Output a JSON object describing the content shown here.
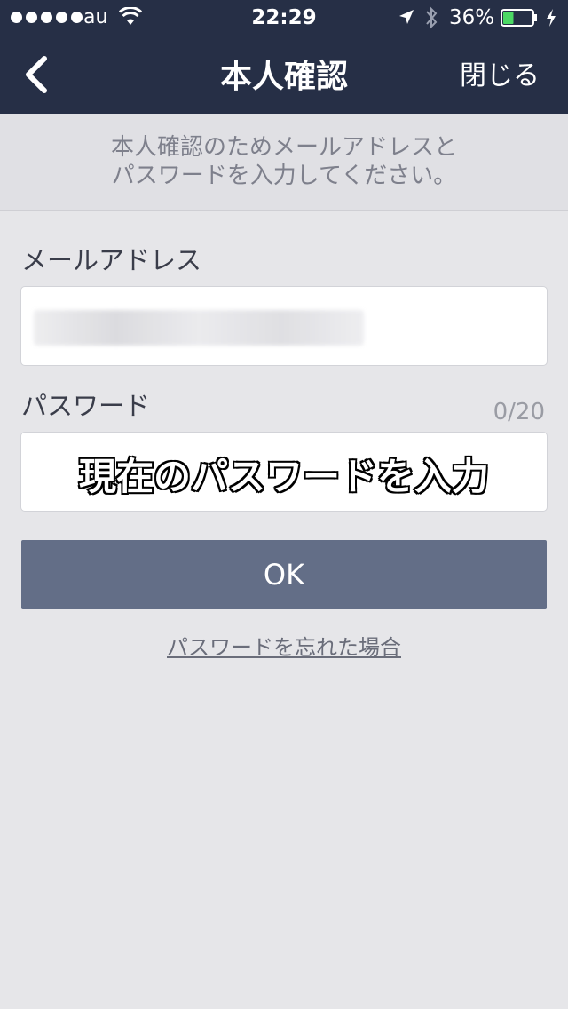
{
  "status_bar": {
    "carrier": "au",
    "time": "22:29",
    "battery_percent": "36%",
    "battery_level": 0.36,
    "battery_color": "#4cd964"
  },
  "nav": {
    "title": "本人確認",
    "close_label": "閉じる",
    "back_icon": "chevron-left-icon",
    "bar_color": "#262f46"
  },
  "notice": {
    "line1": "本人確認のためメールアドレスと",
    "line2": "パスワードを入力してください。"
  },
  "email": {
    "label": "メールアドレス",
    "value_obscured": true
  },
  "password": {
    "label": "パスワード",
    "counter": "0/20",
    "overlay_caption": "現在のパスワードを入力"
  },
  "ok_button": {
    "label": "OK",
    "color": "#636e87"
  },
  "forgot_link": {
    "label": "パスワードを忘れた場合"
  }
}
